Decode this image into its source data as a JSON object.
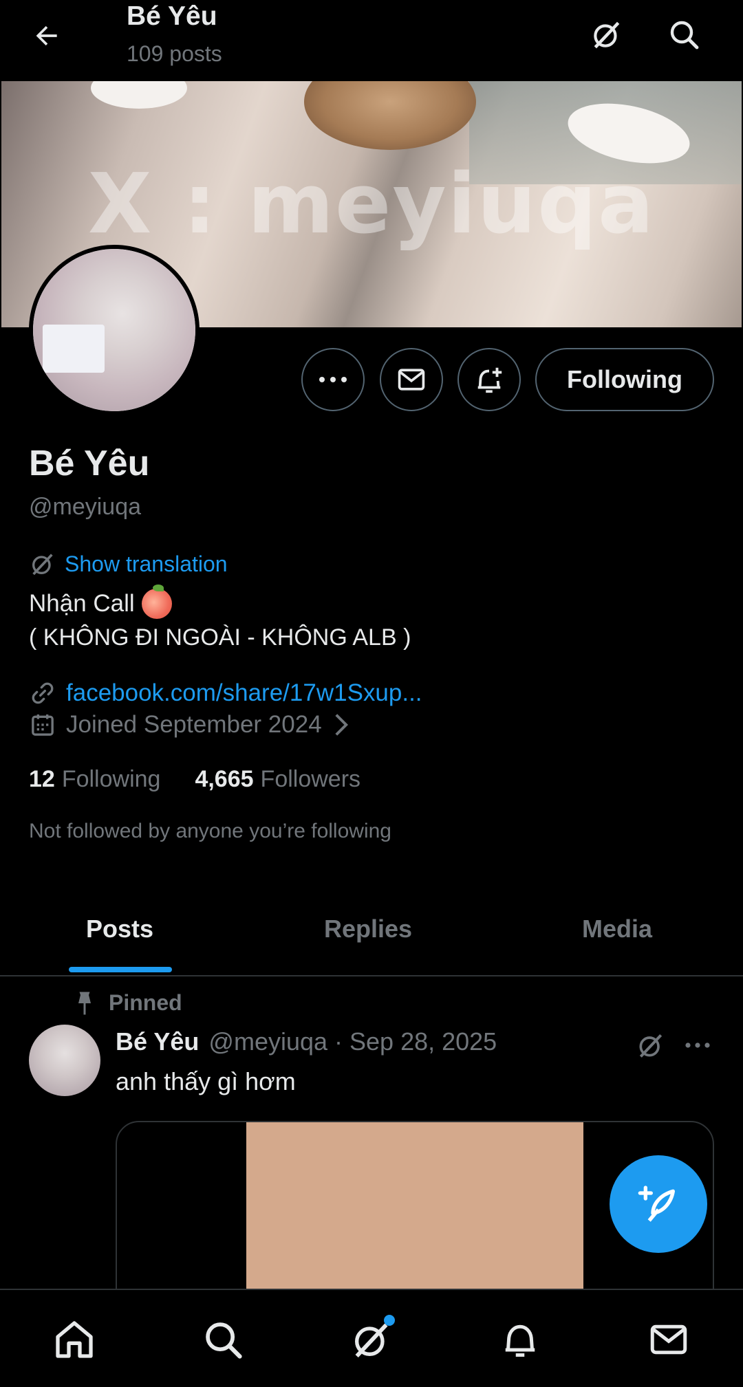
{
  "header": {
    "title": "Bé Yêu",
    "post_count": "109 posts"
  },
  "banner": {
    "watermark": "X : meyiuqa"
  },
  "actions": {
    "following_label": "Following"
  },
  "profile": {
    "name": "Bé Yêu",
    "handle": "@meyiuqa",
    "translate_label": "Show translation",
    "bio_line1": "Nhận Call",
    "bio_line2": "( KHÔNG ĐI NGOÀI - KHÔNG ALB )",
    "link": "facebook.com/share/17w1Sxup...",
    "joined": "Joined September 2024",
    "following_count": "12",
    "following_label": "Following",
    "followers_count": "4,665",
    "followers_label": "Followers",
    "not_followed": "Not followed by anyone you’re following"
  },
  "tabs": [
    {
      "label": "Posts",
      "active": true
    },
    {
      "label": "Replies",
      "active": false
    },
    {
      "label": "Media",
      "active": false
    }
  ],
  "post": {
    "pinned_label": "Pinned",
    "name": "Bé Yêu",
    "meta": "@meyiuqa · Sep 28, 2025",
    "text": "anh thấy gì hơm"
  },
  "colors": {
    "accent": "#1d9bf0",
    "background": "#000000",
    "muted": "#71767b",
    "text": "#e7e9ea"
  },
  "icons": {
    "back": "arrow-left-icon",
    "grok": "grok-icon",
    "search": "search-icon",
    "more": "more-icon",
    "message": "mail-icon",
    "notify": "bell-plus-icon",
    "link": "link-icon",
    "calendar": "calendar-icon",
    "pin": "pin-icon",
    "compose": "feather-plus-icon",
    "home": "home-icon",
    "notifications": "bell-icon"
  }
}
